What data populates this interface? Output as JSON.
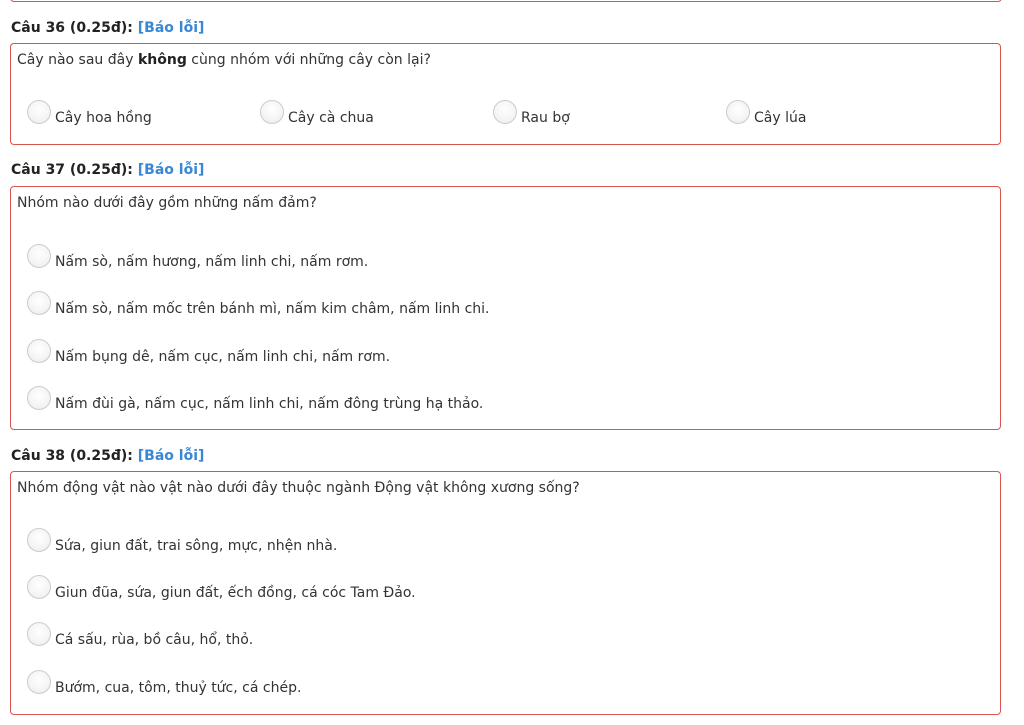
{
  "questions": [
    {
      "header": "Câu 36 (0.25đ):",
      "report": "[Báo lỗi]",
      "text_before": "Cây nào sau đây ",
      "text_bold": "không",
      "text_after": " cùng nhóm với những cây còn lại?",
      "options": [
        "Cây hoa hồng",
        "Cây cà chua",
        "Rau bợ",
        "Cây lúa"
      ]
    },
    {
      "header": "Câu 37 (0.25đ):",
      "report": "[Báo lỗi]",
      "text": "Nhóm nào dưới đây gồm những nấm đảm?",
      "options": [
        "Nấm sò, nấm hương, nấm linh chi, nấm rơm.",
        "Nấm sò, nấm mốc trên bánh mì, nấm kim châm, nấm linh chi.",
        "Nấm bụng dê, nấm cục, nấm linh chi, nấm rơm.",
        "Nấm đùi gà, nấm cục, nấm linh chi, nấm đông trùng hạ thảo."
      ]
    },
    {
      "header": "Câu 38 (0.25đ):",
      "report": "[Báo lỗi]",
      "text": "Nhóm động vật nào vật nào dưới đây thuộc ngành Động vật không xương sống?",
      "options": [
        "Sứa, giun đất, trai sông, mực, nhện nhà.",
        "Giun đũa, sứa, giun đất, ếch đồng, cá cóc Tam Đảo.",
        "Cá sấu, rùa, bồ câu, hổ, thỏ.",
        "Bướm, cua, tôm, thuỷ tức, cá chép."
      ]
    }
  ]
}
